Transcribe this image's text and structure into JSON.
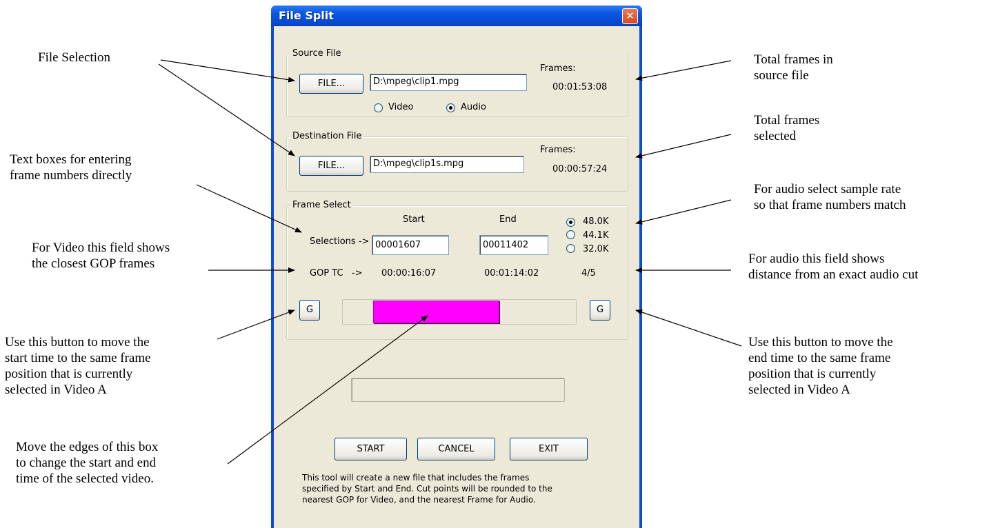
{
  "window": {
    "title": "File Split",
    "close_symbol": "✕"
  },
  "source_file": {
    "group_label": "Source File",
    "file_button": "FILE...",
    "path": "D:\\mpeg\\clip1.mpg",
    "frames_label": "Frames:",
    "frames_value": "00:01:53:08",
    "radio_video": "Video",
    "radio_audio": "Audio",
    "selected_type": "Audio"
  },
  "destination_file": {
    "group_label": "Destination File",
    "file_button": "FILE...",
    "path": "D:\\mpeg\\clip1s.mpg",
    "frames_label": "Frames:",
    "frames_value": "00:00:57:24"
  },
  "frame_select": {
    "group_label": "Frame Select",
    "start_header": "Start",
    "end_header": "End",
    "selections_label": "Selections ->",
    "start_value": "00001607",
    "end_value": "00011402",
    "gop_label": "GOP TC   ->",
    "gop_start": "00:00:16:07",
    "gop_end": "00:01:14:02",
    "audio_distance": "4/5",
    "sample_rates": [
      "48.0K",
      "44.1K",
      "32.0K"
    ],
    "selected_rate": "48.0K",
    "g_left": "G",
    "g_right": "G",
    "selection_start_fraction": 0.13,
    "selection_end_fraction": 0.67
  },
  "actions": {
    "start": "START",
    "cancel": "CANCEL",
    "exit": "EXIT"
  },
  "description": "This tool will create a new file that includes the frames\nspecified by Start and End.  Cut points will be rounded to the\nnearest GOP for Video, and the nearest Frame for Audio.",
  "annotations": {
    "file_selection": "File Selection",
    "text_boxes": "Text boxes for entering\nframe numbers directly",
    "video_gop": "For Video this field shows\nthe closest GOP frames",
    "start_button": "Use this button to move the\nstart time to the same frame\nposition that is currently\nselected in Video A",
    "move_edges": "Move the edges of this box\nto change the start and end\ntime of the selected video.",
    "total_source": "Total frames in\nsource file",
    "total_selected": "Total frames\nselected",
    "audio_rate": "For audio select sample rate\n so that frame numbers match",
    "audio_distance": "For audio this field shows\ndistance from an exact audio cut",
    "end_button": "Use this button to move the\nend time to the same frame\nposition that is currently\nselected in Video A"
  }
}
